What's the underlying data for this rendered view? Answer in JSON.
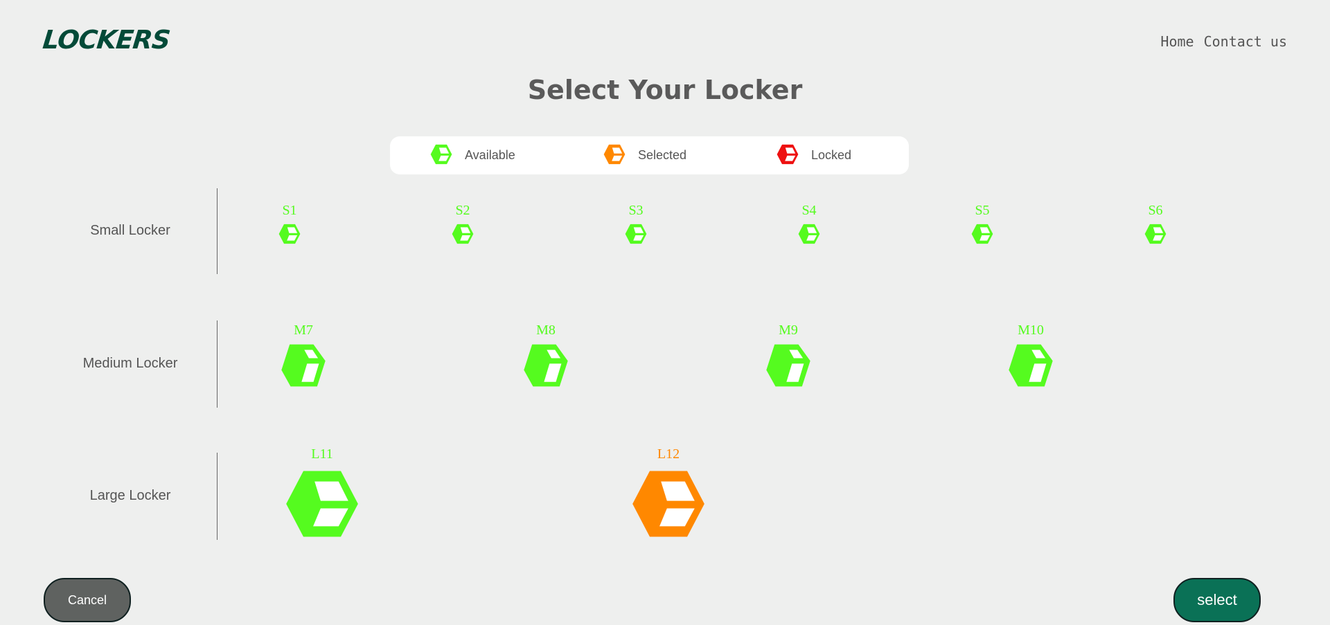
{
  "brand": {
    "logo_text": "LOCKERS"
  },
  "nav": {
    "items": [
      "Home",
      "Contact us"
    ]
  },
  "page_title": "Select Your Locker",
  "colors": {
    "available": "#55fb1f",
    "selected": "#ff8800",
    "locked": "#ee1111",
    "brand": "#024a38",
    "select_button": "#0a7156",
    "cancel_button": "#5f6260"
  },
  "legend": [
    {
      "label": "Available",
      "status": "available",
      "icon": "cube-icon"
    },
    {
      "label": "Selected",
      "status": "selected",
      "icon": "cube-icon"
    },
    {
      "label": "Locked",
      "status": "locked",
      "icon": "cube-icon"
    }
  ],
  "rows": [
    {
      "label": "Small Locker",
      "lockers": [
        {
          "id": "S1",
          "status": "available"
        },
        {
          "id": "S2",
          "status": "available"
        },
        {
          "id": "S3",
          "status": "available"
        },
        {
          "id": "S4",
          "status": "available"
        },
        {
          "id": "S5",
          "status": "available"
        },
        {
          "id": "S6",
          "status": "available"
        }
      ]
    },
    {
      "label": "Medium Locker",
      "lockers": [
        {
          "id": "M7",
          "status": "available"
        },
        {
          "id": "M8",
          "status": "available"
        },
        {
          "id": "M9",
          "status": "available"
        },
        {
          "id": "M10",
          "status": "available"
        }
      ]
    },
    {
      "label": "Large Locker",
      "lockers": [
        {
          "id": "L11",
          "status": "available"
        },
        {
          "id": "L12",
          "status": "selected"
        }
      ]
    }
  ],
  "actions": {
    "cancel_label": "Cancel",
    "select_label": "select"
  }
}
